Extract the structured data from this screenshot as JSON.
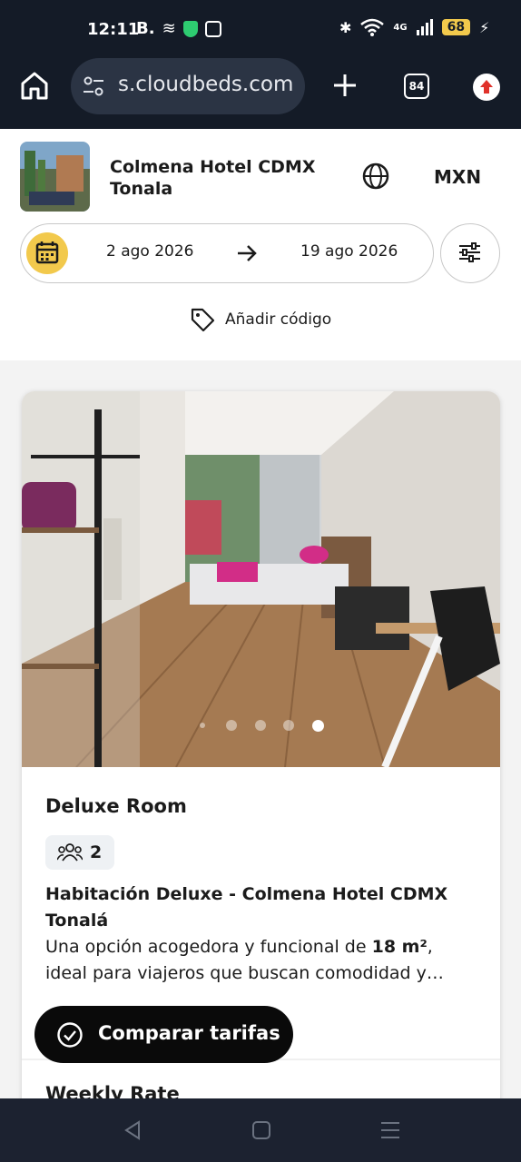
{
  "status_bar": {
    "time": "12:11",
    "left_text": "B.",
    "network": "4G",
    "battery": "68"
  },
  "browser": {
    "url": "s.cloudbeds.com",
    "tab_count": "84"
  },
  "hotel": {
    "name": "Colmena Hotel CDMX Tonala",
    "currency": "MXN"
  },
  "dates": {
    "check_in": "2 ago 2026",
    "check_out": "19 ago 2026"
  },
  "promo": {
    "label": "Añadir código"
  },
  "room": {
    "title": "Deluxe Room",
    "guests": "2",
    "subtitle": "Habitación Deluxe - Colmena Hotel CDMX Tonalá",
    "description_before": "Una opción acogedora y funcional de ",
    "description_bold": "18 m²",
    "description_after": ", ideal para viajeros que buscan comodidad y…",
    "photo_count": 5,
    "active_photo_index": 4
  },
  "rate": {
    "title": "Weekly Rate"
  },
  "compare": {
    "label": "Comparar tarifas"
  },
  "colors": {
    "accent_yellow": "#f2c94c",
    "dark": "#0a0a0a",
    "chrome": "#141b27"
  }
}
